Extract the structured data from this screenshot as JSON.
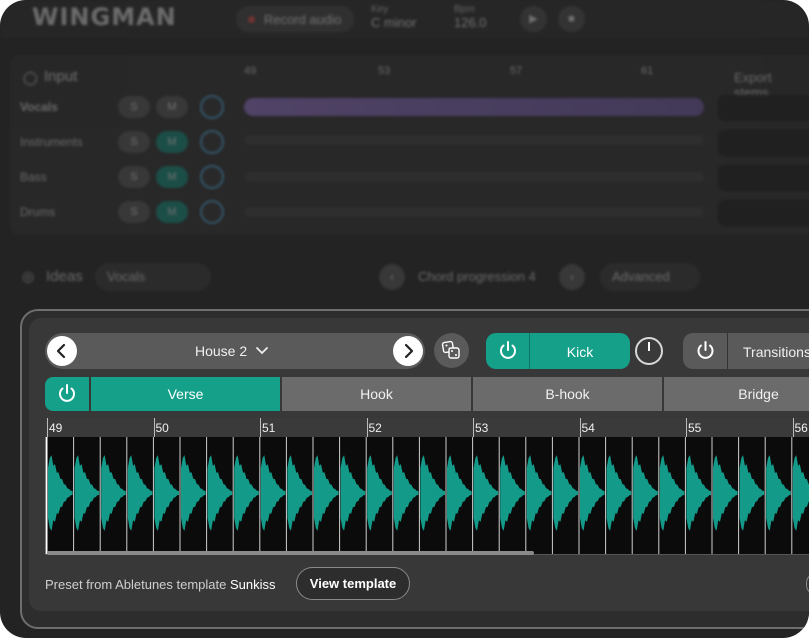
{
  "background": {
    "logo": "WINGMAN",
    "record_label": "Record audio",
    "key": {
      "label": "Key",
      "value": "C minor"
    },
    "bpm": {
      "label": "Bpm",
      "value": "126.0"
    },
    "input": {
      "title": "Input",
      "tracks": [
        {
          "name": "Vocals"
        },
        {
          "name": "Instruments"
        },
        {
          "name": "Bass"
        },
        {
          "name": "Drums"
        }
      ],
      "solo_label": "S",
      "mute_label": "M",
      "ruler": [
        "49",
        "53",
        "57",
        "61"
      ],
      "export_title": "Export stems"
    },
    "ideas": {
      "title": "Ideas",
      "category": "Vocals",
      "idea_name": "Chord progression 4",
      "advanced_label": "Advanced"
    }
  },
  "preset": {
    "name": "House 2",
    "prev_icon": "chevron-left-icon",
    "next_icon": "chevron-right-icon",
    "dice_icon": "dice-icon"
  },
  "instrument": {
    "label": "Kick",
    "enabled": true,
    "power_icon": "power-icon",
    "knob_level": 0.5
  },
  "transitions": {
    "label": "Transitions",
    "enabled": false
  },
  "sections": [
    {
      "label": "Verse",
      "active": true
    },
    {
      "label": "Hook",
      "active": false
    },
    {
      "label": "B-hook",
      "active": false
    },
    {
      "label": "Bridge",
      "active": false
    }
  ],
  "timeline": {
    "bars": [
      "49",
      "50",
      "51",
      "52",
      "53",
      "54",
      "55",
      "56"
    ],
    "scroll_position": 0.62
  },
  "footer": {
    "prefix": "Preset from Abletunes template",
    "template_name": "Sunkiss",
    "view_button": "View template"
  },
  "colors": {
    "accent": "#15a08a",
    "waveform": "#139a88",
    "panel": "#383838"
  }
}
